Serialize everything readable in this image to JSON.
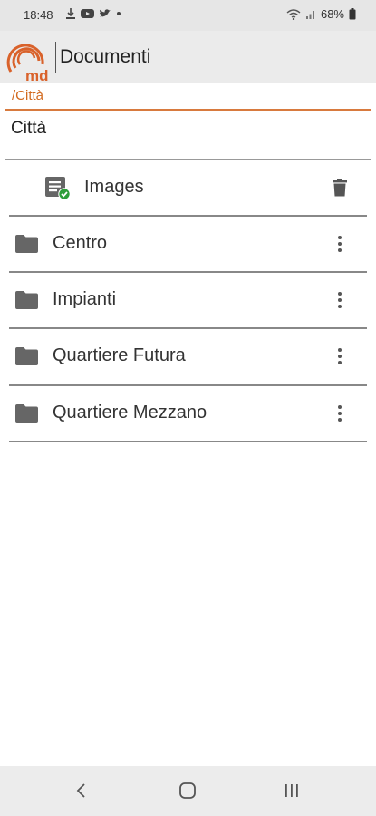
{
  "status_bar": {
    "time": "18:48",
    "battery": "68%"
  },
  "app_bar": {
    "title": "Documenti",
    "logo_text": "md"
  },
  "breadcrumb": "/Città",
  "current_folder": "Città",
  "files": [
    {
      "name": "Images",
      "icon": "document-synced-icon",
      "action": "delete-icon"
    }
  ],
  "folders": [
    {
      "name": "Centro",
      "icon": "folder-icon",
      "action": "more-vert-icon"
    },
    {
      "name": "Impianti",
      "icon": "folder-icon",
      "action": "more-vert-icon"
    },
    {
      "name": "Quartiere Futura",
      "icon": "folder-icon",
      "action": "more-vert-icon"
    },
    {
      "name": "Quartiere Mezzano",
      "icon": "folder-icon",
      "action": "more-vert-icon"
    }
  ],
  "colors": {
    "accent": "#d2691e",
    "icon_gray": "#666666",
    "synced_green": "#2e9e3a"
  }
}
